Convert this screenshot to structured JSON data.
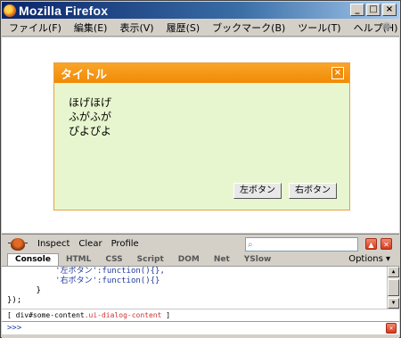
{
  "window": {
    "title": "Mozilla Firefox",
    "buttons": {
      "minimize": "_",
      "maximize": "□",
      "close": "×"
    }
  },
  "menubar": {
    "items": [
      "ファイル(F)",
      "編集(E)",
      "表示(V)",
      "履歴(S)",
      "ブックマーク(B)",
      "ツール(T)",
      "ヘルプ(H)"
    ]
  },
  "dialog": {
    "title": "タイトル",
    "close_glyph": "×",
    "lines": [
      "ほげほげ",
      "ふがふが",
      "ぴよぴよ"
    ],
    "buttons": [
      "左ボタン",
      "右ボタン"
    ]
  },
  "firebug": {
    "toolbar": {
      "inspect": "Inspect",
      "clear": "Clear",
      "profile": "Profile",
      "search_value": ""
    },
    "tabs": [
      "Console",
      "HTML",
      "CSS",
      "Script",
      "DOM",
      "Net",
      "YSlow"
    ],
    "active_tab": "Console",
    "options": "Options ▾",
    "code_lines": [
      "          '左ボタン':function(){},",
      "          '右ボタン':function(){}",
      "      }",
      "});"
    ],
    "status": {
      "open": "[",
      "element": "div#some-content",
      "class": ".ui-dialog-content",
      "close": "]"
    },
    "command_prompt": ">>>"
  },
  "colors": {
    "dialog_header": "#f18a05",
    "dialog_body": "#e8f6cf",
    "titlebar": "#0a246a"
  }
}
